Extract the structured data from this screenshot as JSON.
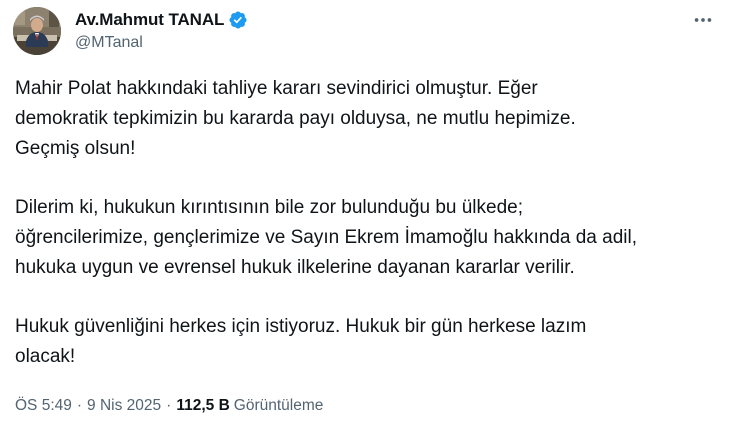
{
  "author": {
    "display_name": "Av.Mahmut TANAL",
    "handle": "@MTanal",
    "verified_badge": "verified-badge-icon",
    "avatar": "profile-photo"
  },
  "tweet": {
    "paragraphs": [
      "Mahir Polat hakkındaki tahliye kararı sevindirici olmuştur. Eğer\ndemokratik tepkimizin bu kararda payı olduysa, ne mutlu hepimize.\nGeçmiş olsun!",
      "Dilerim ki, hukukun kırıntısının bile zor bulunduğu bu ülkede;\nöğrencilerimize, gençlerimize ve Sayın Ekrem İmamoğlu hakkında da adil,\nhukuka uygun ve evrensel hukuk ilkelerine dayanan kararlar verilir.",
      "Hukuk güvenliğini herkes için istiyoruz. Hukuk bir gün herkese lazım\nolacak!"
    ]
  },
  "meta": {
    "time": "ÖS 5:49",
    "separator": "·",
    "date": "9 Nis 2025",
    "views_count": "112,5 B",
    "views_label": "Görüntüleme"
  },
  "icons": {
    "more": "more-options-icon"
  },
  "colors": {
    "text_primary": "#0f1419",
    "text_secondary": "#536471",
    "verified_blue": "#1d9bf0",
    "background": "#ffffff"
  }
}
